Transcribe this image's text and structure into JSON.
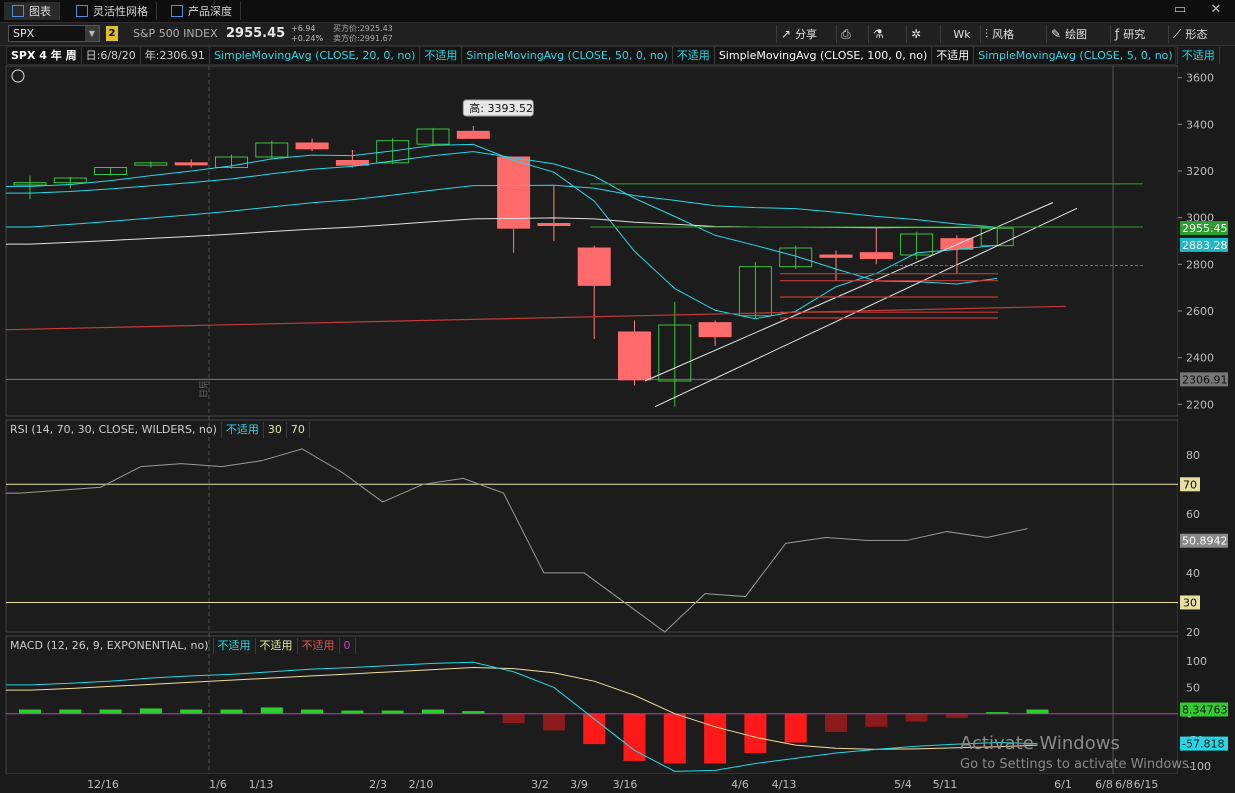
{
  "tabs": [
    {
      "label": "图表",
      "active": true
    },
    {
      "label": "灵活性网格",
      "active": false
    },
    {
      "label": "产品深度",
      "active": false
    }
  ],
  "toolbar": {
    "symbol": "SPX",
    "link_badge": "2",
    "index_name": "S&P 500 INDEX",
    "last": "2955.45",
    "change": "+6.94",
    "change_pct": "+0.24%",
    "bid": "买方价:2925.43",
    "ask": "卖方价:2991.67",
    "share": "分享",
    "style": "风格",
    "draw": "绘图",
    "studies": "研究",
    "patterns": "形态",
    "period": "Wk"
  },
  "studybar": {
    "title": "SPX 4 年 周",
    "date": "日:6/8/20",
    "year_low": "年:2306.91",
    "studies": [
      {
        "label": "SimpleMovingAvg (CLOSE, 20, 0, no)",
        "color": "#22d8e6"
      },
      {
        "label": "不适用",
        "color": "#22d8e6"
      },
      {
        "label": "SimpleMovingAvg (CLOSE, 50, 0, no)",
        "color": "#22d8e6"
      },
      {
        "label": "不适用",
        "color": "#22d8e6"
      },
      {
        "label": "SimpleMovingAvg (CLOSE, 100, 0, no)",
        "color": "#ffffff"
      },
      {
        "label": "不适用",
        "color": "#ffffff"
      },
      {
        "label": "SimpleMovingAvg (CLOSE, 5, 0, no)",
        "color": "#22d8e6"
      },
      {
        "label": "不适用",
        "color": "#22d8e6"
      }
    ]
  },
  "rsi_header": {
    "label": "RSI (14, 70, 30, CLOSE, WILDERS, no)",
    "na": "不适用",
    "ob": "30",
    "os": "70"
  },
  "macd_header": {
    "label": "MACD (12, 26, 9, EXPONENTIAL, no)",
    "na1": "不适用",
    "na2": "不适用",
    "na3": "不适用",
    "zero": "0"
  },
  "price_axis": {
    "ticks": [
      "3600",
      "3400",
      "3200",
      "3000",
      "2800",
      "2600",
      "2400",
      "2200"
    ],
    "labels": [
      {
        "text": "2955.45",
        "color": "#2e9e2e"
      },
      {
        "text": "2883.28",
        "color": "#1fb6c6"
      },
      {
        "text": "2306.91",
        "color": "#777"
      }
    ]
  },
  "rsi_axis": {
    "ticks": [
      "80",
      "70",
      "60",
      "50",
      "40",
      "30",
      "20"
    ],
    "value_label": "50.8942"
  },
  "macd_axis": {
    "ticks": [
      "100",
      "50",
      "0",
      "-50",
      "-100"
    ],
    "value_labels": [
      "8.34763",
      "-57.818"
    ]
  },
  "high_label": "高: 3393.52",
  "side_label": "当日",
  "dates": [
    "12/16",
    "1/6",
    "1/13",
    "2/3",
    "2/10",
    "3/2",
    "3/9",
    "3/16",
    "4/6",
    "4/13",
    "5/4",
    "5/11",
    "6/1",
    "6/8",
    "6/8",
    "6/15"
  ],
  "watermark": {
    "title": "Activate Windows",
    "sub": "Go to Settings to activate Windows."
  },
  "chart_data": {
    "type": "candlestick",
    "price_ylim": [
      2150,
      3650
    ],
    "candles": [
      {
        "o": 3140,
        "h": 3180,
        "l": 3080,
        "c": 3150,
        "up": true
      },
      {
        "o": 3150,
        "h": 3175,
        "l": 3125,
        "c": 3170,
        "up": true
      },
      {
        "o": 3185,
        "h": 3215,
        "l": 3180,
        "c": 3215,
        "up": true
      },
      {
        "o": 3225,
        "h": 3240,
        "l": 3215,
        "c": 3235,
        "up": true
      },
      {
        "o": 3235,
        "h": 3250,
        "l": 3215,
        "c": 3230,
        "up": false
      },
      {
        "o": 3215,
        "h": 3270,
        "l": 3210,
        "c": 3260,
        "up": true
      },
      {
        "o": 3260,
        "h": 3330,
        "l": 3250,
        "c": 3320,
        "up": true
      },
      {
        "o": 3320,
        "h": 3340,
        "l": 3285,
        "c": 3295,
        "up": false
      },
      {
        "o": 3245,
        "h": 3290,
        "l": 3215,
        "c": 3225,
        "up": false
      },
      {
        "o": 3235,
        "h": 3340,
        "l": 3230,
        "c": 3330,
        "up": true
      },
      {
        "o": 3315,
        "h": 3385,
        "l": 3310,
        "c": 3380,
        "up": true
      },
      {
        "o": 3370,
        "h": 3393,
        "l": 3340,
        "c": 3340,
        "up": false
      },
      {
        "o": 3260,
        "h": 3260,
        "l": 2850,
        "c": 2955,
        "up": false
      },
      {
        "o": 2975,
        "h": 3140,
        "l": 2900,
        "c": 2970,
        "up": false
      },
      {
        "o": 2870,
        "h": 2880,
        "l": 2480,
        "c": 2710,
        "up": false
      },
      {
        "o": 2510,
        "h": 2560,
        "l": 2280,
        "c": 2305,
        "up": false
      },
      {
        "o": 2300,
        "h": 2640,
        "l": 2190,
        "c": 2540,
        "up": true
      },
      {
        "o": 2550,
        "h": 2560,
        "l": 2450,
        "c": 2490,
        "up": false
      },
      {
        "o": 2580,
        "h": 2810,
        "l": 2570,
        "c": 2790,
        "up": true
      },
      {
        "o": 2790,
        "h": 2880,
        "l": 2780,
        "c": 2870,
        "up": true
      },
      {
        "o": 2840,
        "h": 2860,
        "l": 2730,
        "c": 2830,
        "up": false
      },
      {
        "o": 2850,
        "h": 2960,
        "l": 2800,
        "c": 2825,
        "up": false
      },
      {
        "o": 2840,
        "h": 2940,
        "l": 2820,
        "c": 2930,
        "up": true
      },
      {
        "o": 2910,
        "h": 2925,
        "l": 2760,
        "c": 2865,
        "up": false
      },
      {
        "o": 2880,
        "h": 2960,
        "l": 2880,
        "c": 2955,
        "up": true
      }
    ],
    "rsi": [
      67,
      68,
      69,
      76,
      77,
      76,
      78,
      82,
      74,
      64,
      70,
      72,
      67,
      40,
      40,
      30,
      20,
      33,
      32,
      50,
      52,
      51,
      51,
      54,
      52,
      55
    ],
    "rsi_ylim": [
      20,
      85
    ],
    "macd_hist": [
      8,
      8,
      8,
      10,
      8,
      8,
      12,
      8,
      6,
      6,
      8,
      5,
      -18,
      -32,
      -58,
      -90,
      -95,
      -95,
      -75,
      -55,
      -35,
      -25,
      -15,
      -8,
      3,
      8
    ],
    "macd_ylim": [
      -115,
      110
    ]
  }
}
